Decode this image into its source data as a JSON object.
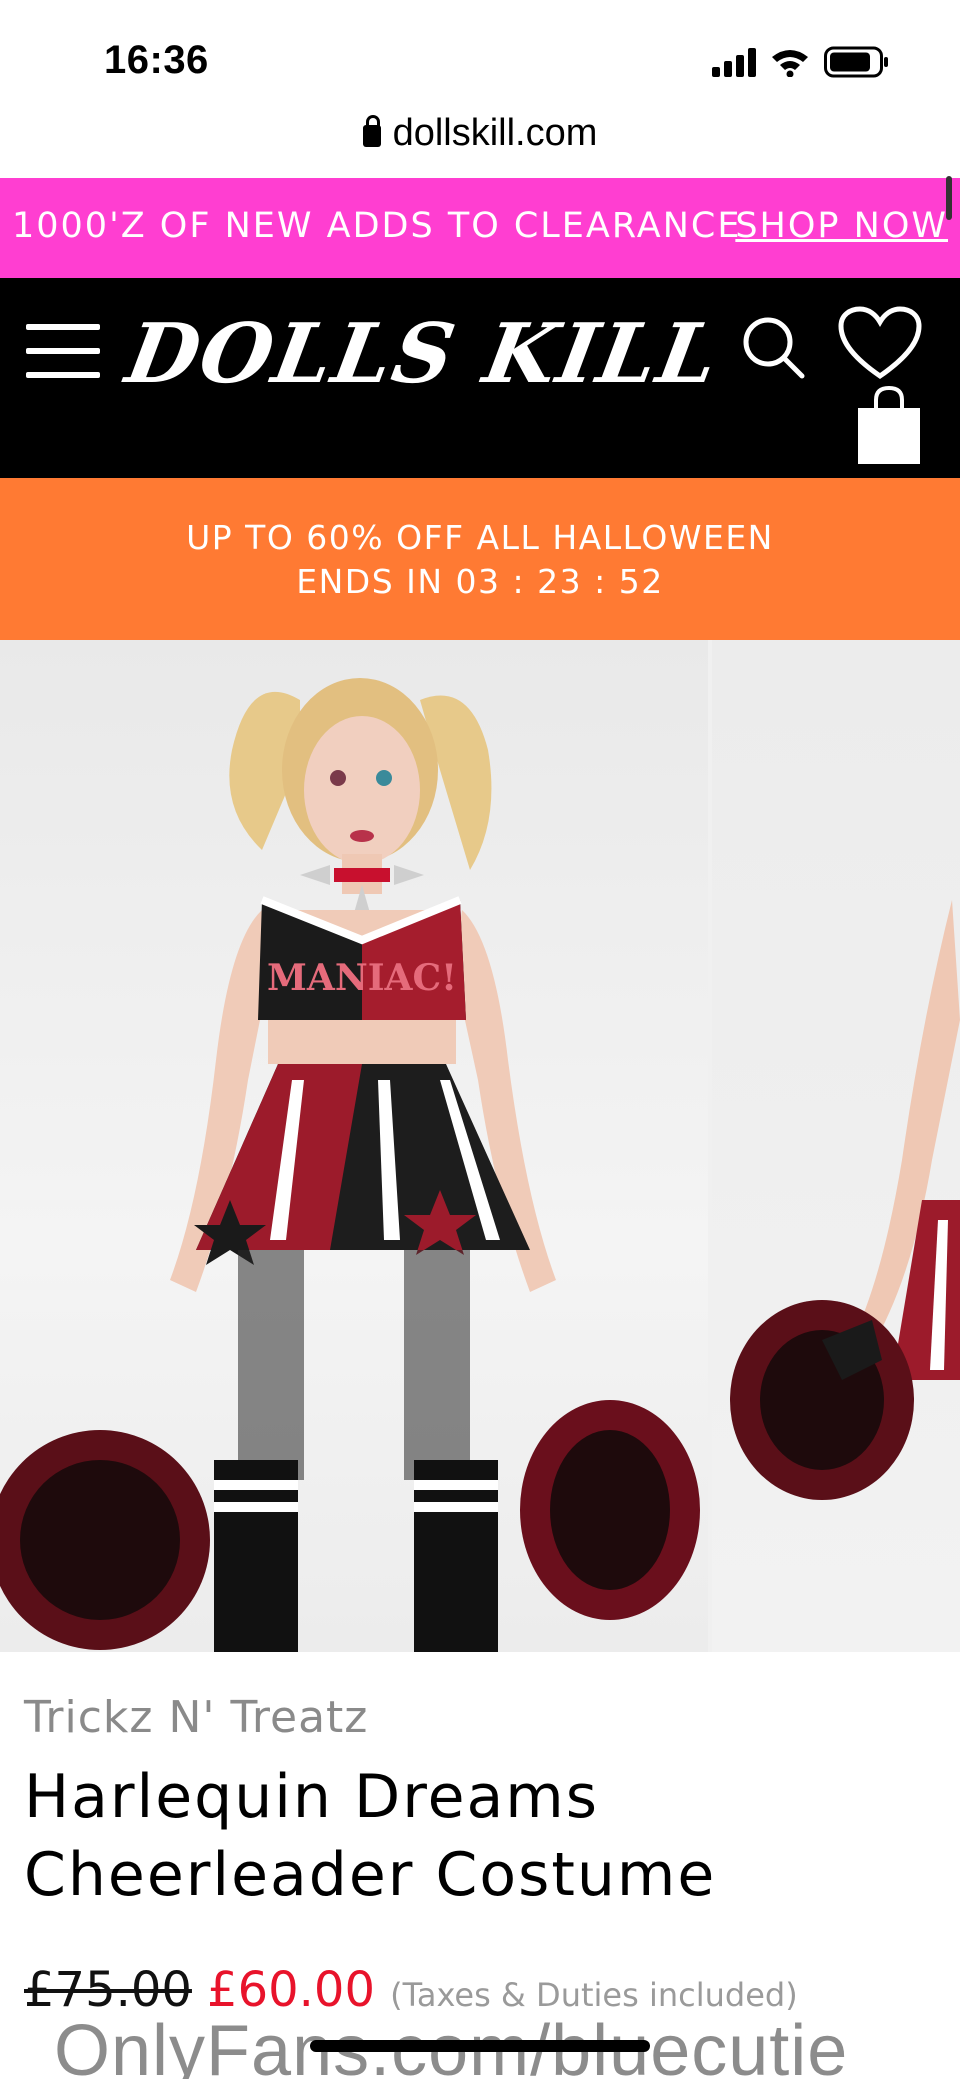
{
  "status_bar": {
    "time": "16:36",
    "icons": [
      "signal-icon",
      "wifi-icon",
      "battery-icon"
    ]
  },
  "browser": {
    "url": "dollskill.com"
  },
  "promo_bar": {
    "text": "1000'Z OF NEW ADDS TO CLEARANCE",
    "link": "SHOP NOW",
    "background": "#ff3ed1"
  },
  "header": {
    "logo": "DOLLS KILL",
    "icons": [
      "menu-icon",
      "search-icon",
      "heart-icon",
      "bag-icon"
    ],
    "background": "#000000"
  },
  "sale_banner": {
    "line1": "UP TO 60% OFF ALL HALLOWEEN",
    "line2": "ENDS IN 03 : 23 : 52",
    "background": "#ff7a33"
  },
  "product": {
    "brand": "Trickz N' Treatz",
    "title": "Harlequin Dreams Cheerleader Costume",
    "price_old": "£75.00",
    "price_new": "£60.00",
    "price_note": "(Taxes & Duties included)",
    "price_color": "#e8132b"
  },
  "watermark": "OnlyFans.com/bluecutie"
}
